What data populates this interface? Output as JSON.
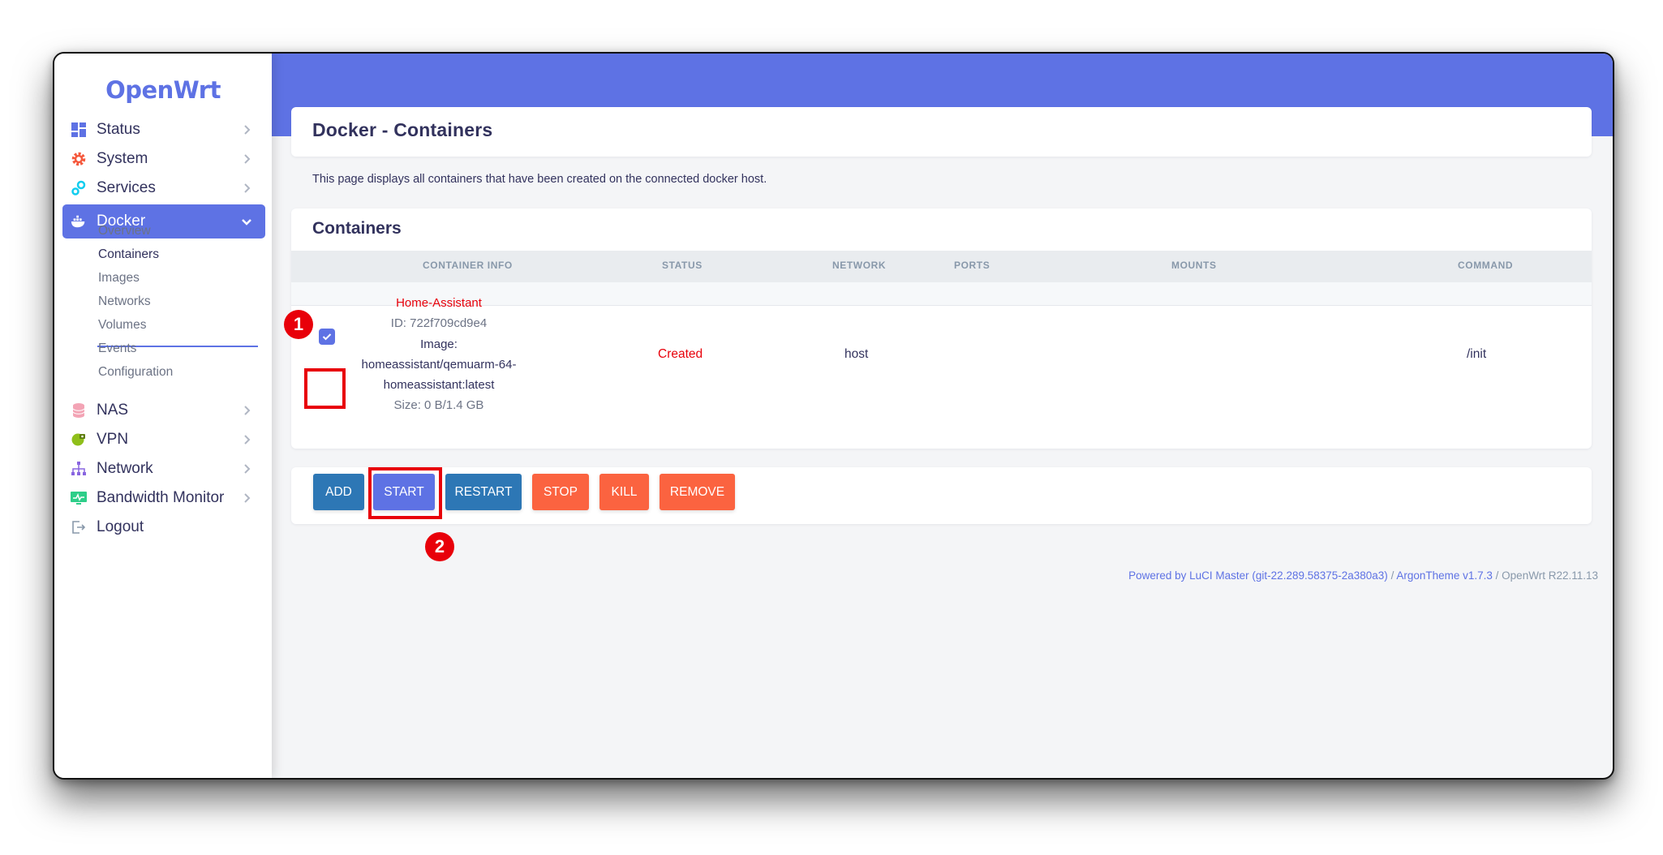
{
  "app": {
    "logo_text": "OpenWrt"
  },
  "sidebar": {
    "items": [
      {
        "label": "Status",
        "icon": "dashboard-icon"
      },
      {
        "label": "System",
        "icon": "gear-icon"
      },
      {
        "label": "Services",
        "icon": "cogs-icon"
      },
      {
        "label": "Docker",
        "icon": "docker-whale-icon",
        "active": true
      },
      {
        "label": "NAS",
        "icon": "database-icon"
      },
      {
        "label": "VPN",
        "icon": "globe-lock-icon"
      },
      {
        "label": "Network",
        "icon": "sitemap-icon"
      },
      {
        "label": "Bandwidth Monitor",
        "icon": "monitor-chart-icon"
      },
      {
        "label": "Logout",
        "icon": "logout-icon"
      }
    ],
    "docker_subitems": [
      "Overview",
      "Containers",
      "Images",
      "Networks",
      "Volumes",
      "Events",
      "Configuration"
    ],
    "active_subitem": "Containers"
  },
  "page": {
    "title": "Docker - Containers",
    "description": "This page displays all containers that have been created on the connected docker host."
  },
  "containers": {
    "section_title": "Containers",
    "columns": [
      "CONTAINER INFO",
      "STATUS",
      "NETWORK",
      "PORTS",
      "MOUNTS",
      "COMMAND"
    ],
    "rows": [
      {
        "selected": true,
        "name": "Home-Assistant",
        "id_line": "ID: 722f709cd9e4",
        "image_label": "Image:",
        "image_line1": "homeassistant/qemuarm-64-",
        "image_line2": "homeassistant:latest",
        "size_line": "Size: 0 B/1.4 GB",
        "status": "Created",
        "network": "host",
        "ports": "",
        "mounts": "",
        "command": "/init"
      }
    ]
  },
  "actions": {
    "add": "ADD",
    "start": "START",
    "restart": "RESTART",
    "stop": "STOP",
    "kill": "KILL",
    "remove": "REMOVE"
  },
  "annotations": {
    "badge1": "1",
    "badge2": "2"
  },
  "footer": {
    "luci": "Powered by LuCI Master (git-22.289.58375-2a380a3)",
    "sep1": " / ",
    "theme": "ArgonTheme v1.7.3",
    "sep2": " / ",
    "version": "OpenWrt R22.11.13"
  },
  "colors": {
    "accent": "#5e72e4",
    "danger": "#fb6340",
    "info_blue": "#2d77b5",
    "highlight_red": "#e8000a",
    "status_created": "#e8000a"
  }
}
